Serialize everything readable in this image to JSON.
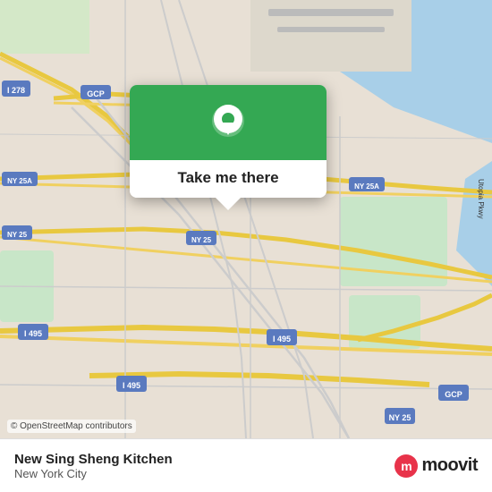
{
  "map": {
    "attribution": "© OpenStreetMap contributors"
  },
  "popup": {
    "button_label": "Take me there",
    "pin_icon": "location-pin"
  },
  "bottom_bar": {
    "title": "New Sing Sheng Kitchen",
    "subtitle": "New York City",
    "logo_text": "moovit",
    "logo_icon": "m"
  }
}
